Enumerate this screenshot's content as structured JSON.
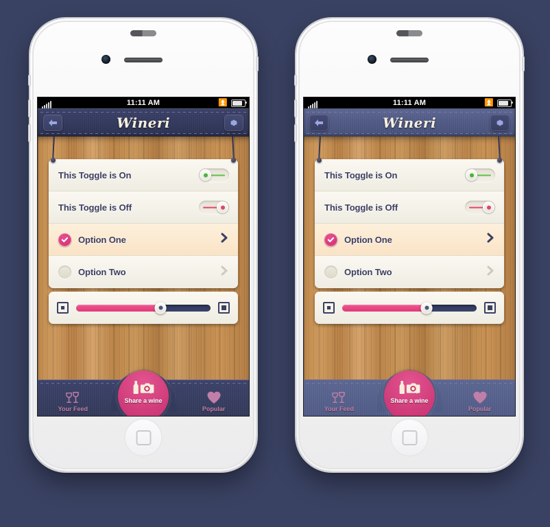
{
  "background_color": "#3a4263",
  "app": {
    "title": "Wineri",
    "status_bar": {
      "time": "11:11 AM",
      "signal_icon": "signal-bars-icon",
      "bluetooth_icon": "bluetooth-icon",
      "battery_icon": "battery-icon",
      "signal_bars": 5
    },
    "nav": {
      "back_icon": "back-arrow-icon",
      "settings_icon": "gear-icon",
      "title_color": "#f7f0e2",
      "bar_color": "#343a5e"
    },
    "settings_list": {
      "rows": [
        {
          "label": "This Toggle is On",
          "type": "toggle",
          "state": "on",
          "accent": "#5fbf4a"
        },
        {
          "label": "This Toggle is Off",
          "type": "toggle",
          "state": "off",
          "accent": "#e0456f"
        },
        {
          "label": "Option One",
          "type": "option",
          "selected": true,
          "icon": "check-circle-filled-icon",
          "chevron": "chevron-right-icon"
        },
        {
          "label": "Option Two",
          "type": "option",
          "selected": false,
          "icon": "check-circle-empty-icon",
          "chevron": "chevron-right-icon"
        }
      ]
    },
    "slider": {
      "left_icon": "small-square-icon",
      "right_icon": "large-square-icon",
      "value_percent": 63,
      "fill_color": "#de3a78",
      "track_color": "#2d3558"
    },
    "tabbar": {
      "tabs": [
        {
          "label": "Your Feed",
          "icon": "wine-glasses-icon",
          "active": false
        },
        {
          "label": "Share a wine",
          "icon": "bottle-camera-icon",
          "active": true
        },
        {
          "label": "Popular",
          "icon": "heart-icon",
          "active": false
        }
      ],
      "accent": "#c62e6f"
    }
  },
  "devices": [
    {
      "name": "iPhone left",
      "variant": "normal",
      "wood_tone": "#c08a4d",
      "nav_tone": "#343a5e"
    },
    {
      "name": "iPhone right",
      "variant": "faded",
      "wood_tone": "#7d5531",
      "nav_tone": "#4e5883"
    }
  ]
}
